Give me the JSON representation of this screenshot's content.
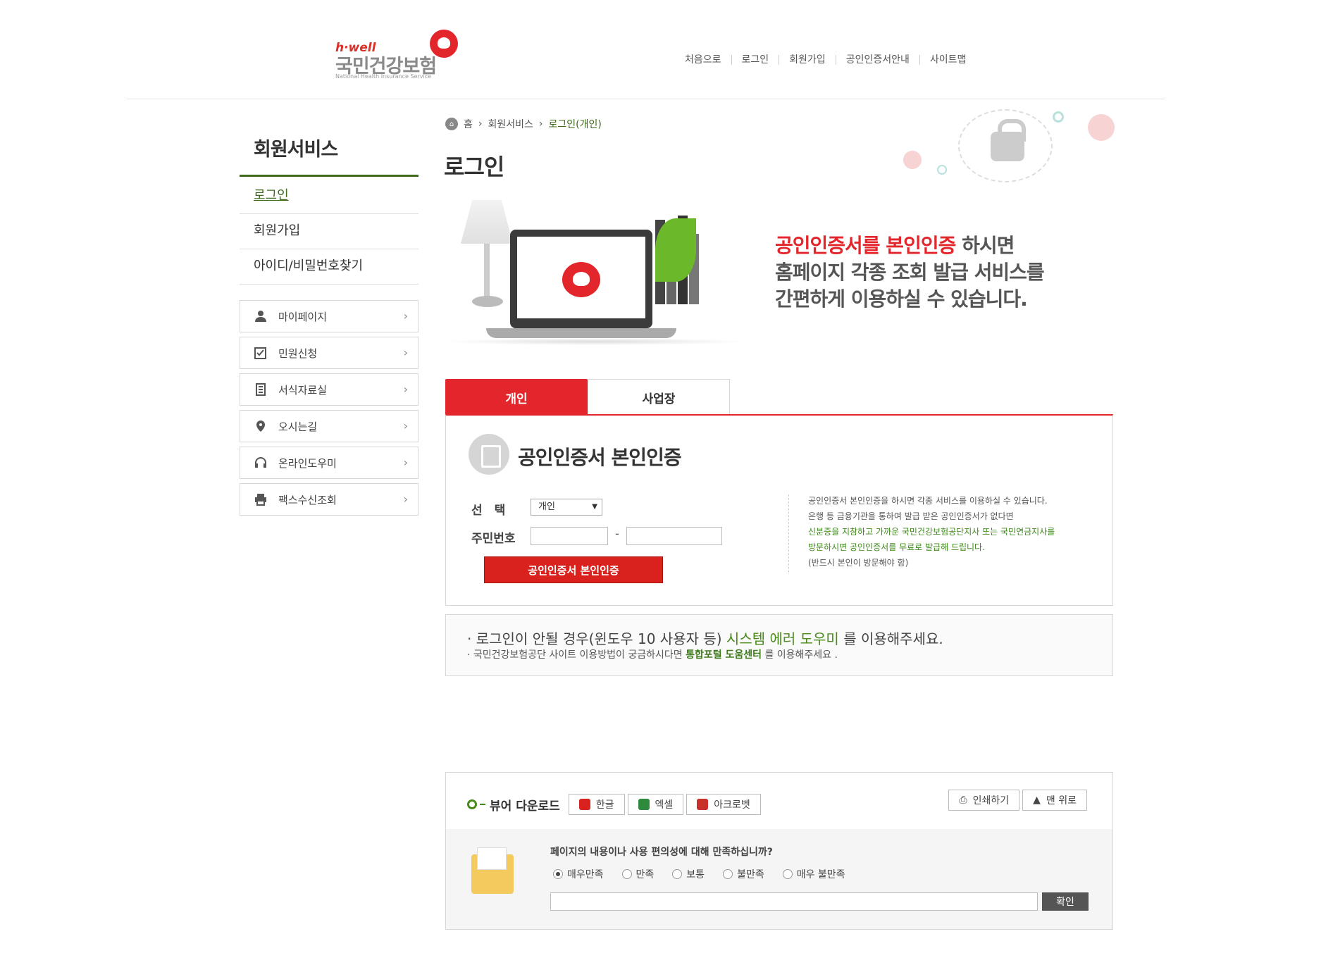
{
  "logo": {
    "brand": "h·well",
    "name": "국민건강보험",
    "sub": "National Health Insurance Service"
  },
  "topnav": [
    "처음으로",
    "로그인",
    "회원가입",
    "공인인증서안내",
    "사이트맵"
  ],
  "sidebar": {
    "title": "회원서비스",
    "items": [
      {
        "label": "로그인",
        "active": true
      },
      {
        "label": "회원가입",
        "active": false
      },
      {
        "label": "아이디/비밀번호찾기",
        "active": false
      }
    ],
    "quick": [
      {
        "label": "마이페이지",
        "icon": "person-icon"
      },
      {
        "label": "민원신청",
        "icon": "checkbox-icon"
      },
      {
        "label": "서식자료실",
        "icon": "document-icon"
      },
      {
        "label": "오시는길",
        "icon": "map-pin-icon"
      },
      {
        "label": "온라인도우미",
        "icon": "headset-icon"
      },
      {
        "label": "팩스수신조회",
        "icon": "printer-icon"
      }
    ]
  },
  "breadcrumb": {
    "home": "홈",
    "section": "회원서비스",
    "current": "로그인(개인)"
  },
  "page_title": "로그인",
  "banner": {
    "line1_red": "공인인증서를 본인인증",
    "line1_rest": " 하시면",
    "line2": "홈페이지 각종 조회 발급 서비스를",
    "line3": "간편하게 이용하실 수 있습니다."
  },
  "tabs": [
    {
      "label": "개인",
      "active": true
    },
    {
      "label": "사업장",
      "active": false
    }
  ],
  "cert": {
    "title": "공인인증서 본인인증",
    "select_label": "선　택",
    "select_value": "개인",
    "rrn_label": "주민번호",
    "button": "공인인증서 본인인증",
    "info": [
      "공인인증서 본인인증을 하시면 각종 서비스를 이용하실 수 있습니다.",
      "은행 등 금융기관을 통하여 발급 받은 공인인증서가 없다면",
      "신분증을 지참하고 가까운 국민건강보험공단지사 또는 국민연금지사를",
      "방문하시면 공인인증서를 무료로 발급해 드립니다.",
      "(반드시 본인이 방문해야 함)"
    ]
  },
  "notice": {
    "line1_a": "로그인이 안될 경우(윈도우 10 사용자 등) ",
    "line1_link": "시스템 에러 도우미",
    "line1_b": " 를 이용해주세요.",
    "line2_a": "국민건강보험공단 사이트 이용방법이 궁금하시다면 ",
    "line2_link": "통합포털 도움센터",
    "line2_b": " 를 이용해주세요 ."
  },
  "viewer": {
    "title": "뷰어 다운로드",
    "buttons": [
      "한글",
      "엑셀",
      "아크로벳"
    ],
    "print": "인쇄하기",
    "top": "맨 위로"
  },
  "survey": {
    "question": "페이지의 내용이나 사용 편의성에 대해 만족하십니까?",
    "options": [
      "매우만족",
      "만족",
      "보통",
      "불만족",
      "매우 불만족"
    ],
    "selected": 0,
    "submit": "확인"
  },
  "colors": {
    "accent_red": "#e3262b",
    "green": "#3d6b1a"
  }
}
